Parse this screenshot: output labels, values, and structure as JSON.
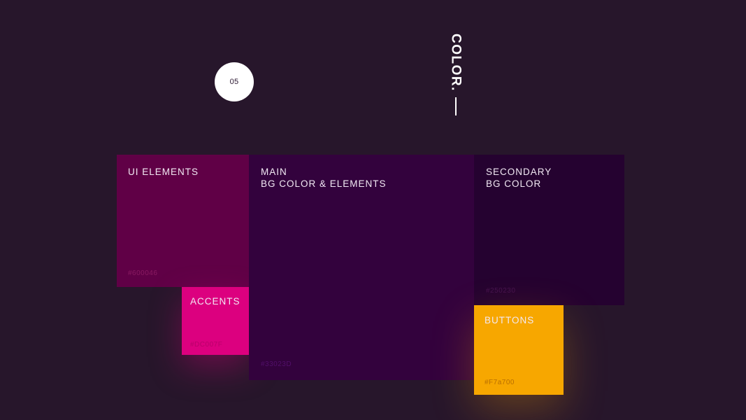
{
  "page": {
    "section_number": "05",
    "section_title": "COLOR."
  },
  "swatches": {
    "ui_elements": {
      "label": "UI ELEMENTS",
      "hex": "#600046",
      "color": "#600046"
    },
    "accents": {
      "label": "ACCENTS",
      "hex": "#DC007F",
      "color": "#DC007F"
    },
    "main": {
      "label": "MAIN\nBG COLOR & ELEMENTS",
      "hex": "#33023D",
      "color": "#33023D"
    },
    "secondary": {
      "label": "SECONDARY\nBG COLOR",
      "hex": "#250230",
      "color": "#250230"
    },
    "buttons": {
      "label": "BUTTONS",
      "hex": "#F7a700",
      "color": "#F7A700"
    }
  },
  "colors": {
    "background": "#27162B",
    "badge": "#FFFFFF",
    "title": "#FFFFFF"
  }
}
